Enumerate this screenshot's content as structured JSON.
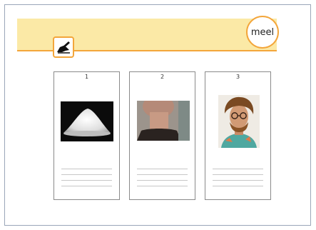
{
  "header": {
    "word": "meel",
    "icon": "hand-writing-icon",
    "banner_color": "#fbe9a6",
    "accent_color": "#f3a63b"
  },
  "cards": [
    {
      "number": "1",
      "image": "flour-pile-photo"
    },
    {
      "number": "2",
      "image": "neck-photo"
    },
    {
      "number": "3",
      "image": "curly-haired-man-photo"
    }
  ]
}
